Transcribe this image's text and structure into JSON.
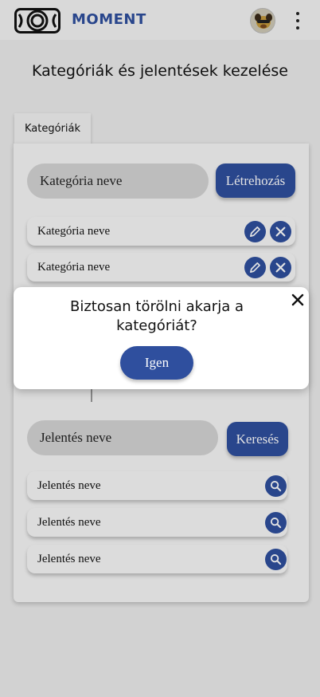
{
  "header": {
    "brand": "MOMENT",
    "brand_color": "#2f4f9e"
  },
  "page": {
    "title": "Kategóriák és jelentések kezelése"
  },
  "tabs": [
    {
      "label": "Kategóriák"
    }
  ],
  "categories": {
    "input_placeholder": "Kategória neve",
    "create_label": "Létrehozás",
    "items": [
      {
        "label": "Kategória neve"
      },
      {
        "label": "Kategória neve"
      }
    ]
  },
  "reports": {
    "input_placeholder": "Jelentés neve",
    "search_label": "Keresés",
    "items": [
      {
        "label": "Jelentés neve"
      },
      {
        "label": "Jelentés neve"
      },
      {
        "label": "Jelentés neve"
      }
    ]
  },
  "dialog": {
    "message": "Biztosan törölni akarja a kategóriát?",
    "confirm_label": "Igen"
  },
  "icons": {
    "logo": "film-reel-logo",
    "edit": "pencil-icon",
    "delete": "close-icon",
    "search": "magnifier-icon",
    "menu": "kebab-menu-icon"
  }
}
